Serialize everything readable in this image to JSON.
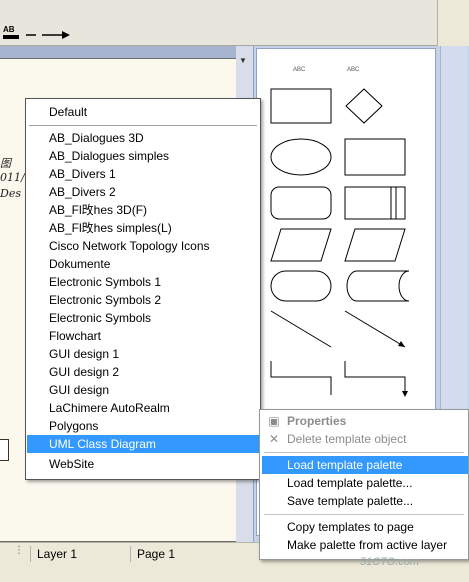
{
  "toolbar": {
    "text_style_icon": "text-style-icon",
    "arrow_line_icon": "arrow-line-icon",
    "text_style_label": "AB"
  },
  "canvas": {
    "fragment_1": "图",
    "fragment_2": "011/",
    "fragment_3": "Des"
  },
  "template_list": {
    "items": [
      "Default",
      "AB_Dialogues 3D",
      "AB_Dialogues simples",
      "AB_Divers 1",
      "AB_Divers 2",
      "AB_Fl攺hes 3D(F)",
      "AB_Fl攺hes simples(L)",
      "Cisco Network Topology Icons",
      "Dokumente",
      "Electronic Symbols 1",
      "Electronic Symbols 2",
      "Electronic Symbols",
      "Flowchart",
      "GUI design 1",
      "GUI design 2",
      "GUI design",
      "LaChimere AutoRealm",
      "Polygons",
      "UML Class Diagram",
      "WebSite"
    ],
    "selected": "UML Class Diagram"
  },
  "palette": {
    "shape_label_left": "ABC",
    "shape_label_right": "ABC"
  },
  "context_menu": {
    "properties": "Properties",
    "delete_template_object": "Delete template object",
    "load_template_palette": "Load template palette",
    "load_template_palette_dots": "Load template palette...",
    "save_template_palette": "Save template palette...",
    "copy_templates_to_page": "Copy templates to page",
    "make_palette_from_active_layer": "Make palette from active layer"
  },
  "statusbar": {
    "layer": "Layer 1",
    "page": "Page 1"
  },
  "watermark": "51CTO.com",
  "colors": {
    "selection": "#3399ff",
    "palette_bg": "#c5d3ea",
    "canvas_bg": "#a7b4cf"
  }
}
